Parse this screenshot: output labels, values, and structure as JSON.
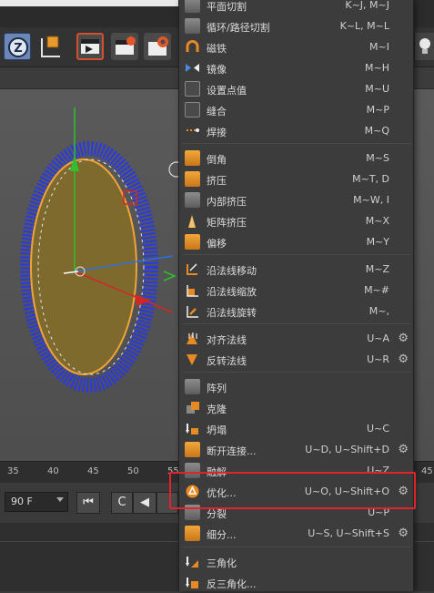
{
  "toolbar": {
    "icons": [
      "z-axis-lock-icon",
      "coordinate-system-icon",
      "render-view-icon",
      "render-active-icon",
      "render-settings-icon",
      "light-bulb-icon"
    ]
  },
  "viewport": {
    "object": "disc-with-normals"
  },
  "timeline": {
    "ticks": [
      "35",
      "40",
      "45",
      "50",
      "55",
      "45"
    ]
  },
  "playback": {
    "frame_value": "90 F",
    "buttons": [
      "⏮",
      "C",
      "◀"
    ]
  },
  "menu": {
    "items": [
      {
        "label": "平面切割",
        "shortcut": "K~J, M~J",
        "icon": "plane-cut-icon",
        "gear": false
      },
      {
        "label": "循环/路径切割",
        "shortcut": "K~L, M~L",
        "icon": "loop-path-cut-icon",
        "gear": false
      },
      {
        "label": "磁铁",
        "shortcut": "M~I",
        "icon": "magnet-icon",
        "gear": false
      },
      {
        "label": "镜像",
        "shortcut": "M~H",
        "icon": "mirror-icon",
        "gear": false
      },
      {
        "label": "设置点值",
        "shortcut": "M~U",
        "icon": "set-point-value-icon",
        "gear": false
      },
      {
        "label": "缝合",
        "shortcut": "M~P",
        "icon": "stitch-icon",
        "gear": false
      },
      {
        "label": "焊接",
        "shortcut": "M~Q",
        "icon": "weld-icon",
        "gear": false
      },
      {
        "label": "倒角",
        "shortcut": "M~S",
        "icon": "bevel-icon",
        "gear": false
      },
      {
        "label": "挤压",
        "shortcut": "M~T, D",
        "icon": "extrude-icon",
        "gear": false
      },
      {
        "label": "内部挤压",
        "shortcut": "M~W, I",
        "icon": "extrude-inner-icon",
        "gear": false
      },
      {
        "label": "矩阵挤压",
        "shortcut": "M~X",
        "icon": "matrix-extrude-icon",
        "gear": false
      },
      {
        "label": "偏移",
        "shortcut": "M~Y",
        "icon": "offset-icon",
        "gear": false
      },
      {
        "label": "沿法线移动",
        "shortcut": "M~Z",
        "icon": "normal-move-icon",
        "gear": false
      },
      {
        "label": "沿法线缩放",
        "shortcut": "M~#",
        "icon": "normal-scale-icon",
        "gear": false
      },
      {
        "label": "沿法线旋转",
        "shortcut": "M~,",
        "icon": "normal-rotate-icon",
        "gear": false
      },
      {
        "label": "对齐法线",
        "shortcut": "U~A",
        "icon": "align-normals-icon",
        "gear": true
      },
      {
        "label": "反转法线",
        "shortcut": "U~R",
        "icon": "reverse-normals-icon",
        "gear": true
      },
      {
        "label": "阵列",
        "shortcut": "",
        "icon": "array-icon",
        "gear": false
      },
      {
        "label": "克隆",
        "shortcut": "",
        "icon": "clone-icon",
        "gear": false
      },
      {
        "label": "坍塌",
        "shortcut": "U~C",
        "icon": "collapse-icon",
        "gear": false
      },
      {
        "label": "断开连接...",
        "shortcut": "U~D, U~Shift+D",
        "icon": "disconnect-icon",
        "gear": true
      },
      {
        "label": "融解",
        "shortcut": "U~Z",
        "icon": "melt-icon",
        "gear": false
      },
      {
        "label": "优化...",
        "shortcut": "U~O, U~Shift+O",
        "icon": "optimize-icon",
        "gear": true
      },
      {
        "label": "分裂",
        "shortcut": "U~P",
        "icon": "split-icon",
        "gear": false
      },
      {
        "label": "细分...",
        "shortcut": "U~S, U~Shift+S",
        "icon": "subdivide-icon",
        "gear": true
      },
      {
        "label": "三角化",
        "shortcut": "",
        "icon": "triangulate-icon",
        "gear": false
      },
      {
        "label": "反三角化...",
        "shortcut": "",
        "icon": "untriangulate-icon",
        "gear": false
      }
    ],
    "highlighted": "优化..."
  }
}
